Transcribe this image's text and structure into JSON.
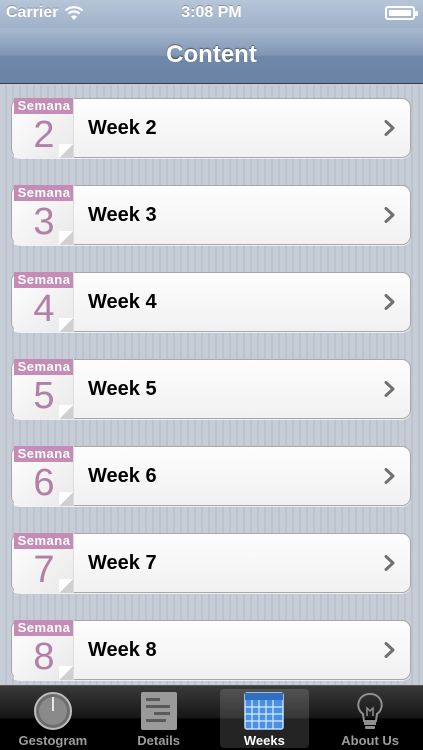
{
  "status_bar": {
    "carrier": "Carrier",
    "time": "3:08 PM"
  },
  "nav": {
    "title": "Content"
  },
  "weeks": [
    {
      "badge": "Semana",
      "number": "2",
      "label": "Week 2"
    },
    {
      "badge": "Semana",
      "number": "3",
      "label": "Week 3"
    },
    {
      "badge": "Semana",
      "number": "4",
      "label": "Week 4"
    },
    {
      "badge": "Semana",
      "number": "5",
      "label": "Week 5"
    },
    {
      "badge": "Semana",
      "number": "6",
      "label": "Week 6"
    },
    {
      "badge": "Semana",
      "number": "7",
      "label": "Week 7"
    },
    {
      "badge": "Semana",
      "number": "8",
      "label": "Week 8"
    }
  ],
  "tab_bar": {
    "tabs": [
      {
        "label": "Gestogram",
        "icon": "gestogram-dial-icon",
        "selected": false
      },
      {
        "label": "Details",
        "icon": "details-list-icon",
        "selected": false
      },
      {
        "label": "Weeks",
        "icon": "weeks-calendar-icon",
        "selected": true
      },
      {
        "label": "About Us",
        "icon": "lightbulb-icon",
        "selected": false
      }
    ]
  },
  "colors": {
    "nav_bar": "#7f95b4",
    "badge": "#c58db6",
    "badge_number": "#b27fa5",
    "selected_tab_icon": "#4a90e2"
  }
}
